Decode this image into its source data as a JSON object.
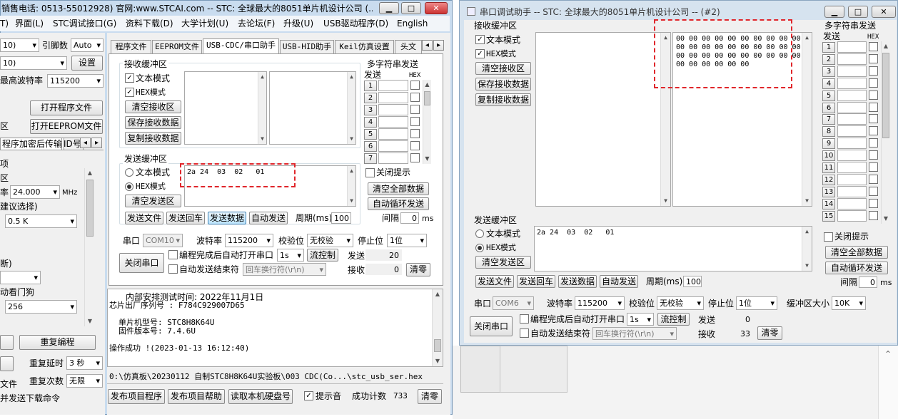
{
  "w1": {
    "title": "销售电话: 0513-55012928) 官网:www.STCAI.com  -- STC: 全球最大的8051单片机设计公司 (...",
    "menu": [
      "T)",
      "界面(L)",
      "STC调试接口(G)",
      "资料下载(D)",
      "大学计划(U)",
      "去论坛(F)",
      "升级(U)",
      "USB驱动程序(D)",
      "English"
    ],
    "left": {
      "pin_label": "引脚数",
      "pin_value": "Auto",
      "port_value": "10)",
      "settings_btn": "设置",
      "maxbaud_label": "最高波特率",
      "maxbaud_value": "115200",
      "open_prog": "打开程序文件",
      "open_eeprom": "打开EEPROM文件",
      "area_label": "区",
      "enc_tab": "程序加密后传输",
      "id_tab": "ID号",
      "item1": "项",
      "item2": "区",
      "freq_label": "率",
      "freq_value": "24.000",
      "freq_unit": "MHz",
      "suggest": "建议选择)",
      "size_value": "0.5 K",
      "cut": "断)",
      "watchdog": "动看门狗",
      "wd_value": "256",
      "reprogram": "重复编程",
      "delay_label": "重复延时",
      "delay_value": "3 秒",
      "count_label": "重复次数",
      "count_value": "无限",
      "file_label": "文件",
      "dl_label": "并发送下载命令"
    },
    "tabs": [
      "程序文件",
      "EEPROM文件",
      "USB-CDC/串口助手",
      "USB-HID助手",
      "Keil仿真设置",
      "头文"
    ],
    "recv": {
      "title": "接收缓冲区",
      "text_mode": "文本模式",
      "hex_mode": "HEX模式",
      "clear": "清空接收区",
      "save": "保存接收数据",
      "copy": "复制接收数据"
    },
    "multi": {
      "title": "多字符串发送",
      "send": "发送",
      "hex": "HEX",
      "rows": [
        "1",
        "2",
        "3",
        "4",
        "5",
        "6",
        "7"
      ]
    },
    "send": {
      "title": "发送缓冲区",
      "text_mode": "文本模式",
      "hex_mode": "HEX模式",
      "clear": "清空发送区",
      "content": "2a 24  03  02   01",
      "send_file": "发送文件",
      "send_cr": "发送回车",
      "send_data": "发送数据",
      "auto_send": "自动发送",
      "period_label": "周期(ms)",
      "period_value": "100"
    },
    "right": {
      "close_hint": "关闭提示",
      "clear_all": "清空全部数据",
      "auto_loop": "自动循环发送",
      "interval_label": "间隔",
      "interval_value": "0",
      "interval_unit": "ms"
    },
    "port": {
      "port_label": "串口",
      "port_value": "COM10",
      "baud_label": "波特率",
      "baud_value": "115200",
      "parity_label": "校验位",
      "parity_value": "无校验",
      "stop_label": "停止位",
      "stop_value": "1位",
      "close_port": "关闭串口",
      "auto_open": "编程完成后自动打开串口",
      "time_value": "1s",
      "flow": "流控制",
      "send_label": "发送",
      "send_count": "20",
      "auto_end": "自动发送结束符",
      "end_value": "回车换行符(\\r\\n)",
      "recv_label": "接收",
      "recv_count": "0",
      "clear_btn": "清零"
    },
    "log": [
      "内部安排测试时间: 2022年11月1日",
      "芯片出厂序列号 : F784C929007D65",
      "",
      "单片机型号: STC8H8K64U",
      "固件版本号: 7.4.6U",
      "",
      "操作成功 !(2023-01-13 16:12:40)"
    ],
    "path": "0:\\仿真板\\20230112 自制STC8H8K64U实验板\\003 CDC(Co...\\stc_usb_ser.hex",
    "bottom": {
      "publish": "发布项目程序",
      "publish_help": "发布项目帮助",
      "read_disk": "读取本机硬盘号",
      "beep": "提示音",
      "success_label": "成功计数",
      "success_value": "733",
      "clear": "清零"
    }
  },
  "w2": {
    "title": "串口调试助手 -- STC: 全球最大的8051单片机设计公司 -- (#2)",
    "recv": {
      "title": "接收缓冲区",
      "text_mode": "文本模式",
      "hex_mode": "HEX模式",
      "clear": "清空接收区",
      "save": "保存接收数据",
      "copy": "复制接收数据",
      "hex_lines": [
        "00 00 00 00 00 00 00 00 00 00",
        "00 00 00 00 00 00 00 00 00 00",
        "00 00 00 00 00 00 00 00 00 00",
        "00 00 00 00 00 00"
      ]
    },
    "multi": {
      "title": "多字符串发送",
      "send": "发送",
      "hex": "HEX",
      "rows": [
        "1",
        "2",
        "3",
        "4",
        "5",
        "6",
        "7",
        "8",
        "9",
        "10",
        "11",
        "12",
        "13",
        "14",
        "15"
      ]
    },
    "send": {
      "title": "发送缓冲区",
      "text_mode": "文本模式",
      "hex_mode": "HEX模式",
      "clear": "清空发送区",
      "content": "2a 24  03  02   01",
      "send_file": "发送文件",
      "send_cr": "发送回车",
      "send_data": "发送数据",
      "auto_send": "自动发送",
      "period_label": "周期(ms)",
      "period_value": "100"
    },
    "right": {
      "close_hint": "关闭提示",
      "clear_all": "清空全部数据",
      "auto_loop": "自动循环发送",
      "interval_label": "间隔",
      "interval_value": "0",
      "interval_unit": "ms"
    },
    "port": {
      "port_label": "串口",
      "port_value": "COM6",
      "baud_label": "波特率",
      "baud_value": "115200",
      "parity_label": "校验位",
      "parity_value": "无校验",
      "stop_label": "停止位",
      "stop_value": "1位",
      "buf_label": "缓冲区大小",
      "buf_value": "10K",
      "close_port": "关闭串口",
      "auto_open": "编程完成后自动打开串口",
      "time_value": "1s",
      "flow": "流控制",
      "send_label": "发送",
      "send_count": "0",
      "auto_end": "自动发送结束符",
      "end_value": "回车换行符(\\r\\n)",
      "recv_label": "接收",
      "recv_count": "33",
      "clear_btn": "清零"
    }
  }
}
